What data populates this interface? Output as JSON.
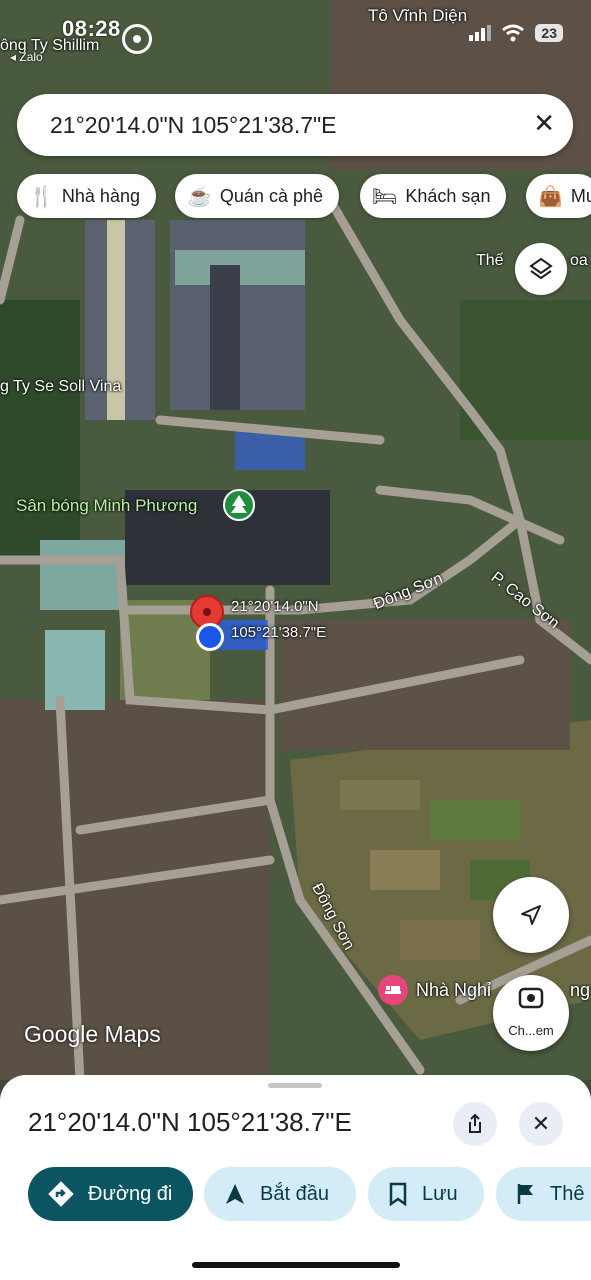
{
  "status_bar": {
    "time": "08:28",
    "back_app": "◂ Zalo",
    "battery": "23"
  },
  "search": {
    "query": "21°20'14.0\"N 105°21'38.7\"E"
  },
  "chips": [
    {
      "label": "Nhà hàng",
      "icon": "restaurant-icon"
    },
    {
      "label": "Quán cà phê",
      "icon": "coffee-icon"
    },
    {
      "label": "Khách sạn",
      "icon": "hotel-icon"
    },
    {
      "label": "Mu",
      "icon": "shopping-bag-icon"
    }
  ],
  "map": {
    "labels": {
      "to_vinh_dien": "Tô Vĩnh Diện",
      "cong_ty_shillim": "ông Ty Shillim",
      "the": "Thế",
      "hoa": "oa",
      "se_soll_vina": "g Ty Se Soll Vina",
      "san_bong": "Sân bóng Minh Phương",
      "dong_son_1": "Đông Sơn",
      "cao_son": "P. Cao Sơn",
      "dong_son_2": "Đông Sơn",
      "nha_nghi": "Nhà Nghỉ",
      "nha_nghi_tail": "ng"
    },
    "pin_lat": "21°20'14.0\"N",
    "pin_lng": "105°21'38.7\"E",
    "attribution": "Google Maps"
  },
  "lens_label": "Ch...em",
  "sheet": {
    "title": "21°20'14.0\"N 105°21'38.7\"E",
    "actions": {
      "directions": "Đường đi",
      "start": "Bắt đầu",
      "save": "Lưu",
      "more": "Thê"
    }
  }
}
